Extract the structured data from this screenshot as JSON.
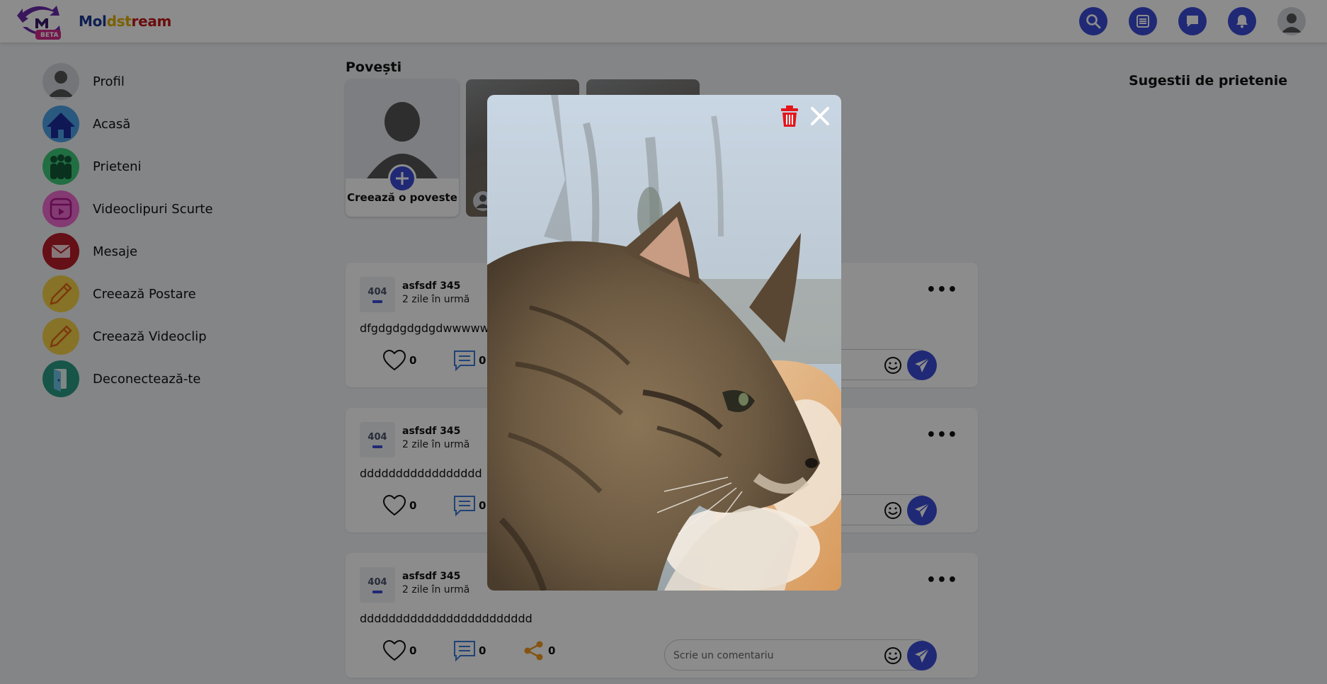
{
  "header": {
    "logo_letter": "M",
    "logo_badge": "BETA",
    "brand_part1": "Mol",
    "brand_part2": "dst",
    "brand_part3": "ream",
    "icons": [
      "search-icon",
      "menu-icon",
      "chat-icon",
      "bell-icon",
      "avatar"
    ]
  },
  "colors": {
    "accent": "#3b4cd6",
    "brand_blue": "#1d3a94",
    "brand_yellow": "#e0b000",
    "brand_red": "#c21818",
    "delete": "#e3151a"
  },
  "sidebar": {
    "items": [
      {
        "label": "Profil",
        "icon": "profile-icon"
      },
      {
        "label": "Acasă",
        "icon": "home-icon"
      },
      {
        "label": "Prieteni",
        "icon": "friends-icon"
      },
      {
        "label": "Videoclipuri Scurte",
        "icon": "reels-icon"
      },
      {
        "label": "Mesaje",
        "icon": "mail-icon"
      },
      {
        "label": "Creează Postare",
        "icon": "pencil-icon"
      },
      {
        "label": "Creează Videoclip",
        "icon": "pencil-icon"
      },
      {
        "label": "Deconectează-te",
        "icon": "logout-icon"
      }
    ]
  },
  "stories": {
    "title": "Povești",
    "create_label": "Creează o poveste"
  },
  "posts": [
    {
      "avatar_text": "404",
      "author": "asfsdf 345",
      "time": "2 zile în urmă",
      "text": "dfgdgdgdgdgdwwwww",
      "likes": "0",
      "comments": "0"
    },
    {
      "avatar_text": "404",
      "author": "asfsdf 345",
      "time": "2 zile în urmă",
      "text": "ddddddddddddddddd",
      "likes": "0",
      "comments": "0"
    },
    {
      "avatar_text": "404",
      "author": "asfsdf 345",
      "time": "2 zile în urmă",
      "text": "dddddddddddddddddddddddd",
      "likes": "0",
      "comments": "0",
      "shares": "0",
      "comment_placeholder": "Scrie un comentariu"
    }
  ],
  "suggestions": {
    "title": "Sugestii de prietenie"
  },
  "story_viewer": {
    "delete_icon": "trash-icon",
    "close_icon": "close-icon",
    "image_subject": "tabby cat profile photo"
  }
}
